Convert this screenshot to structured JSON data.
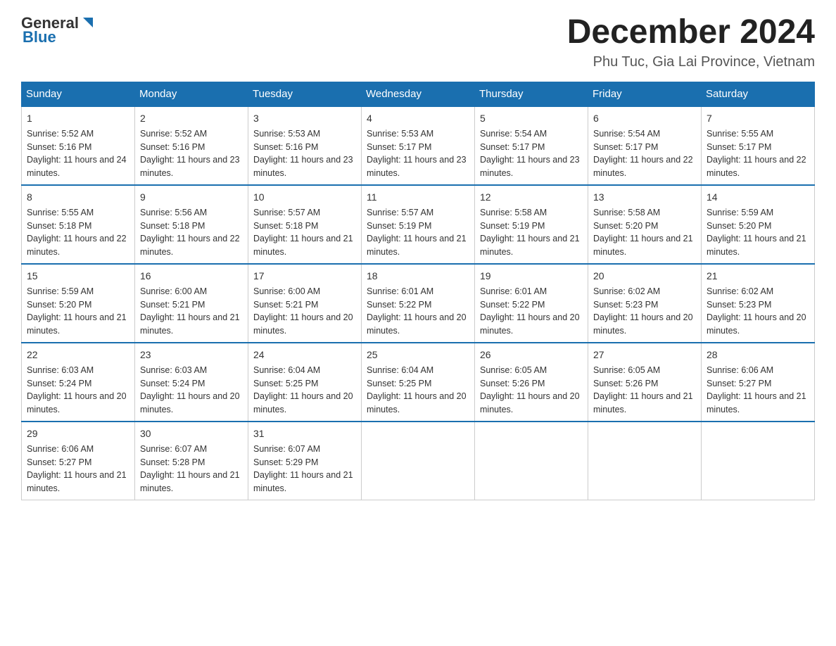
{
  "header": {
    "logo_general": "General",
    "logo_blue": "Blue",
    "month_title": "December 2024",
    "location": "Phu Tuc, Gia Lai Province, Vietnam"
  },
  "days_of_week": [
    "Sunday",
    "Monday",
    "Tuesday",
    "Wednesday",
    "Thursday",
    "Friday",
    "Saturday"
  ],
  "weeks": [
    [
      {
        "day": "1",
        "sunrise": "5:52 AM",
        "sunset": "5:16 PM",
        "daylight": "11 hours and 24 minutes."
      },
      {
        "day": "2",
        "sunrise": "5:52 AM",
        "sunset": "5:16 PM",
        "daylight": "11 hours and 23 minutes."
      },
      {
        "day": "3",
        "sunrise": "5:53 AM",
        "sunset": "5:16 PM",
        "daylight": "11 hours and 23 minutes."
      },
      {
        "day": "4",
        "sunrise": "5:53 AM",
        "sunset": "5:17 PM",
        "daylight": "11 hours and 23 minutes."
      },
      {
        "day": "5",
        "sunrise": "5:54 AM",
        "sunset": "5:17 PM",
        "daylight": "11 hours and 23 minutes."
      },
      {
        "day": "6",
        "sunrise": "5:54 AM",
        "sunset": "5:17 PM",
        "daylight": "11 hours and 22 minutes."
      },
      {
        "day": "7",
        "sunrise": "5:55 AM",
        "sunset": "5:17 PM",
        "daylight": "11 hours and 22 minutes."
      }
    ],
    [
      {
        "day": "8",
        "sunrise": "5:55 AM",
        "sunset": "5:18 PM",
        "daylight": "11 hours and 22 minutes."
      },
      {
        "day": "9",
        "sunrise": "5:56 AM",
        "sunset": "5:18 PM",
        "daylight": "11 hours and 22 minutes."
      },
      {
        "day": "10",
        "sunrise": "5:57 AM",
        "sunset": "5:18 PM",
        "daylight": "11 hours and 21 minutes."
      },
      {
        "day": "11",
        "sunrise": "5:57 AM",
        "sunset": "5:19 PM",
        "daylight": "11 hours and 21 minutes."
      },
      {
        "day": "12",
        "sunrise": "5:58 AM",
        "sunset": "5:19 PM",
        "daylight": "11 hours and 21 minutes."
      },
      {
        "day": "13",
        "sunrise": "5:58 AM",
        "sunset": "5:20 PM",
        "daylight": "11 hours and 21 minutes."
      },
      {
        "day": "14",
        "sunrise": "5:59 AM",
        "sunset": "5:20 PM",
        "daylight": "11 hours and 21 minutes."
      }
    ],
    [
      {
        "day": "15",
        "sunrise": "5:59 AM",
        "sunset": "5:20 PM",
        "daylight": "11 hours and 21 minutes."
      },
      {
        "day": "16",
        "sunrise": "6:00 AM",
        "sunset": "5:21 PM",
        "daylight": "11 hours and 21 minutes."
      },
      {
        "day": "17",
        "sunrise": "6:00 AM",
        "sunset": "5:21 PM",
        "daylight": "11 hours and 20 minutes."
      },
      {
        "day": "18",
        "sunrise": "6:01 AM",
        "sunset": "5:22 PM",
        "daylight": "11 hours and 20 minutes."
      },
      {
        "day": "19",
        "sunrise": "6:01 AM",
        "sunset": "5:22 PM",
        "daylight": "11 hours and 20 minutes."
      },
      {
        "day": "20",
        "sunrise": "6:02 AM",
        "sunset": "5:23 PM",
        "daylight": "11 hours and 20 minutes."
      },
      {
        "day": "21",
        "sunrise": "6:02 AM",
        "sunset": "5:23 PM",
        "daylight": "11 hours and 20 minutes."
      }
    ],
    [
      {
        "day": "22",
        "sunrise": "6:03 AM",
        "sunset": "5:24 PM",
        "daylight": "11 hours and 20 minutes."
      },
      {
        "day": "23",
        "sunrise": "6:03 AM",
        "sunset": "5:24 PM",
        "daylight": "11 hours and 20 minutes."
      },
      {
        "day": "24",
        "sunrise": "6:04 AM",
        "sunset": "5:25 PM",
        "daylight": "11 hours and 20 minutes."
      },
      {
        "day": "25",
        "sunrise": "6:04 AM",
        "sunset": "5:25 PM",
        "daylight": "11 hours and 20 minutes."
      },
      {
        "day": "26",
        "sunrise": "6:05 AM",
        "sunset": "5:26 PM",
        "daylight": "11 hours and 20 minutes."
      },
      {
        "day": "27",
        "sunrise": "6:05 AM",
        "sunset": "5:26 PM",
        "daylight": "11 hours and 21 minutes."
      },
      {
        "day": "28",
        "sunrise": "6:06 AM",
        "sunset": "5:27 PM",
        "daylight": "11 hours and 21 minutes."
      }
    ],
    [
      {
        "day": "29",
        "sunrise": "6:06 AM",
        "sunset": "5:27 PM",
        "daylight": "11 hours and 21 minutes."
      },
      {
        "day": "30",
        "sunrise": "6:07 AM",
        "sunset": "5:28 PM",
        "daylight": "11 hours and 21 minutes."
      },
      {
        "day": "31",
        "sunrise": "6:07 AM",
        "sunset": "5:29 PM",
        "daylight": "11 hours and 21 minutes."
      },
      null,
      null,
      null,
      null
    ]
  ]
}
